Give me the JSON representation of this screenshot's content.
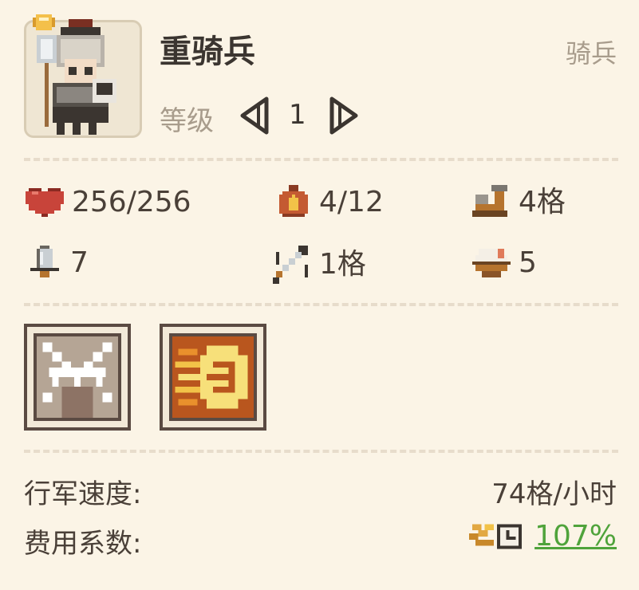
{
  "unit": {
    "name": "重骑兵",
    "type": "骑兵",
    "level_label": "等级",
    "level": "1"
  },
  "stats": {
    "hp": "256/256",
    "fire": "4/12",
    "move": "4格",
    "attack": "7",
    "range": "1格",
    "food": "5"
  },
  "skills": [
    {
      "icon": "crossed-weapons-skill-icon"
    },
    {
      "icon": "fire-charge-skill-icon"
    }
  ],
  "info": {
    "march_speed_label": "行军速度:",
    "march_speed_value": "74格/小时",
    "cost_label": "费用系数:",
    "cost_value": "107%"
  },
  "colors": {
    "background": "#fbf4e6",
    "cost_accent": "#4fa33b",
    "muted_text": "#a89c8c"
  }
}
